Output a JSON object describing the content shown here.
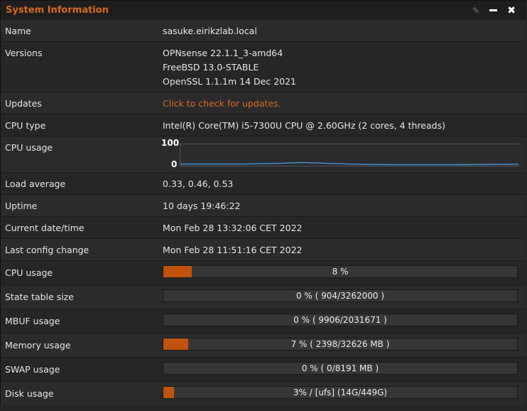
{
  "widget": {
    "title": "System Information",
    "icons": [
      "pencil-icon",
      "minimize-icon",
      "close-icon"
    ]
  },
  "rows": {
    "name": {
      "label": "Name",
      "value": "sasuke.eirikzlab.local"
    },
    "versions": {
      "label": "Versions",
      "lines": [
        "OPNsense 22.1.1_3-amd64",
        "FreeBSD 13.0-STABLE",
        "OpenSSL 1.1.1m 14 Dec 2021"
      ]
    },
    "updates": {
      "label": "Updates",
      "value": "Click to check for updates."
    },
    "cpu_type": {
      "label": "CPU type",
      "value": "Intel(R) Core(TM) i5-7300U CPU @ 2.60GHz (2 cores, 4 threads)"
    },
    "cpu_graph": {
      "label": "CPU usage",
      "ymax": "100",
      "ymin": "0"
    },
    "load": {
      "label": "Load average",
      "value": "0.33, 0.46, 0.53"
    },
    "uptime": {
      "label": "Uptime",
      "value": "10 days 19:46:22"
    },
    "datetime": {
      "label": "Current date/time",
      "value": "Mon Feb 28 13:32:06 CET 2022"
    },
    "config": {
      "label": "Last config change",
      "value": "Mon Feb 28 11:51:16 CET 2022"
    }
  },
  "bars": [
    {
      "label": "CPU usage",
      "text": "8 %",
      "percent": 8
    },
    {
      "label": "State table size",
      "text": "0 % ( 904/3262000 )",
      "percent": 0
    },
    {
      "label": "MBUF usage",
      "text": "0 % ( 9906/2031671 )",
      "percent": 0
    },
    {
      "label": "Memory usage",
      "text": "7 % ( 2398/32626 MB )",
      "percent": 7
    },
    {
      "label": "SWAP usage",
      "text": "0 % ( 0/8191 MB )",
      "percent": 0
    },
    {
      "label": "Disk usage",
      "text": "3% / [ufs] (14G/449G)",
      "percent": 3
    }
  ],
  "cpu_history": [
    8,
    8,
    8,
    10,
    15,
    10,
    6,
    5,
    5,
    5,
    6,
    7
  ],
  "colors": {
    "accent": "#d86a1e",
    "bar_fill": "#c0530d",
    "graph_line": "#3f8fd0"
  }
}
